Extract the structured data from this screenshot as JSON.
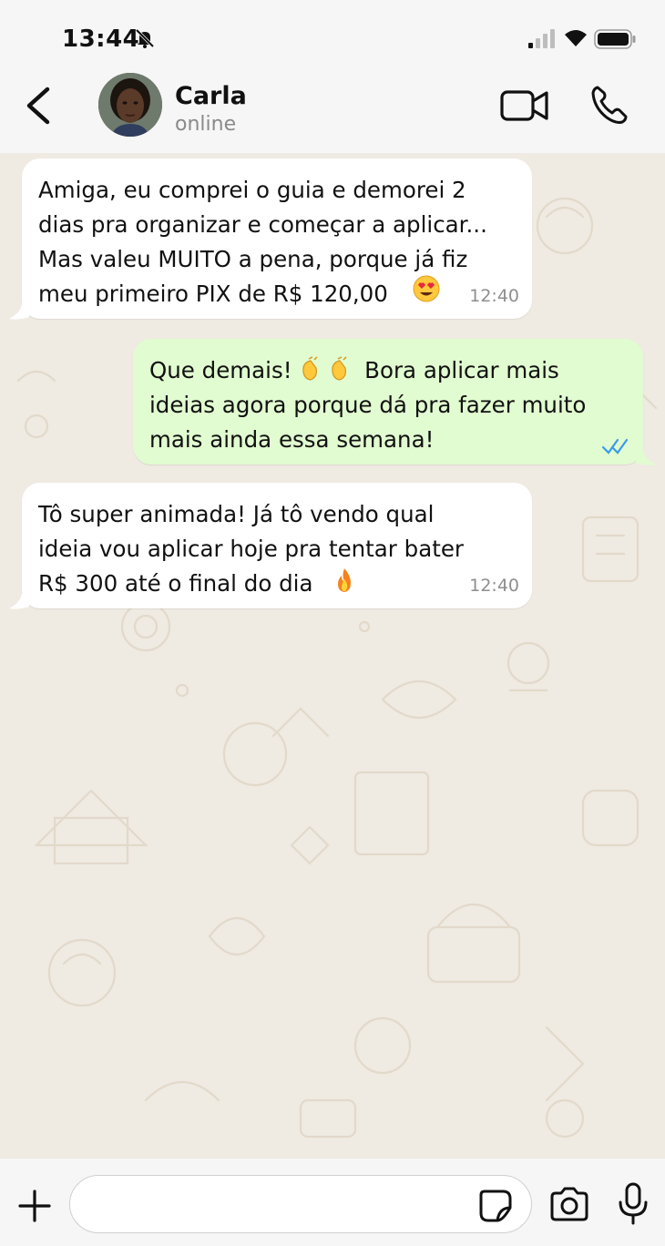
{
  "status_bar": {
    "time": "13:44",
    "icons": [
      "bell-off-icon",
      "signal-icon",
      "wifi-icon",
      "battery-icon"
    ]
  },
  "header": {
    "contact_name": "Carla",
    "contact_status": "online",
    "icons": [
      "back-chevron-icon",
      "avatar",
      "video-call-icon",
      "phone-call-icon"
    ]
  },
  "messages": [
    {
      "direction": "incoming",
      "text": "Amiga, eu comprei o guia e demorei 2\ndias pra organizar e começar a aplicar...\nMas valeu MUITO a pena, porque já fiz\nmeu primeiro PIX de R$ 120,00",
      "emoji": "heart-eyes-emoji",
      "time": "12:40"
    },
    {
      "direction": "outgoing",
      "text_start": "Que demais!",
      "emoji": "clapping-hands-emoji",
      "text_end": "Bora aplicar mais\nideias agora porque dá pra fazer muito\nmais ainda essa semana!",
      "status": "read-double-check-icon"
    },
    {
      "direction": "incoming",
      "text": "Tô super animada! Já tô vendo qual\nideia vou aplicar hoje pra tentar bater\nR$ 300 até o final do dia",
      "emoji": "fire-emoji",
      "time": "12:40"
    }
  ],
  "input_bar": {
    "placeholder": "",
    "icons": [
      "plus-icon",
      "sticker-icon",
      "camera-icon",
      "microphone-icon"
    ]
  },
  "colors": {
    "chat_background": "#efeae2",
    "incoming_bubble": "#ffffff",
    "outgoing_bubble": "#e1fcd0",
    "read_checks": "#3a9bea",
    "timestamp": "#8e8e8e"
  }
}
